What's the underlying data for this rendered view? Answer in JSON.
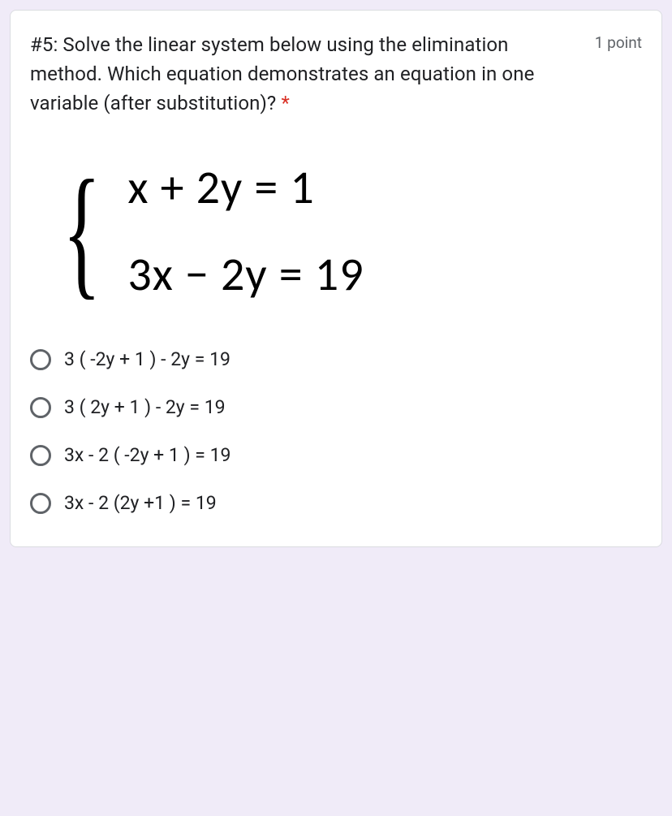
{
  "question": {
    "text": "#5: Solve the linear system below using the elimination method. Which equation demonstrates an equation in one variable (after substitution)?",
    "required_marker": "*",
    "points": "1 point"
  },
  "equations": {
    "eq1": "x + 2y = 1",
    "eq2": "3x − 2y = 19"
  },
  "options": [
    {
      "label": "3 ( -2y + 1 ) - 2y = 19"
    },
    {
      "label": "3 ( 2y + 1 ) - 2y = 19"
    },
    {
      "label": "3x - 2 ( -2y + 1 ) = 19"
    },
    {
      "label": "3x - 2 (2y +1 ) = 19"
    }
  ]
}
